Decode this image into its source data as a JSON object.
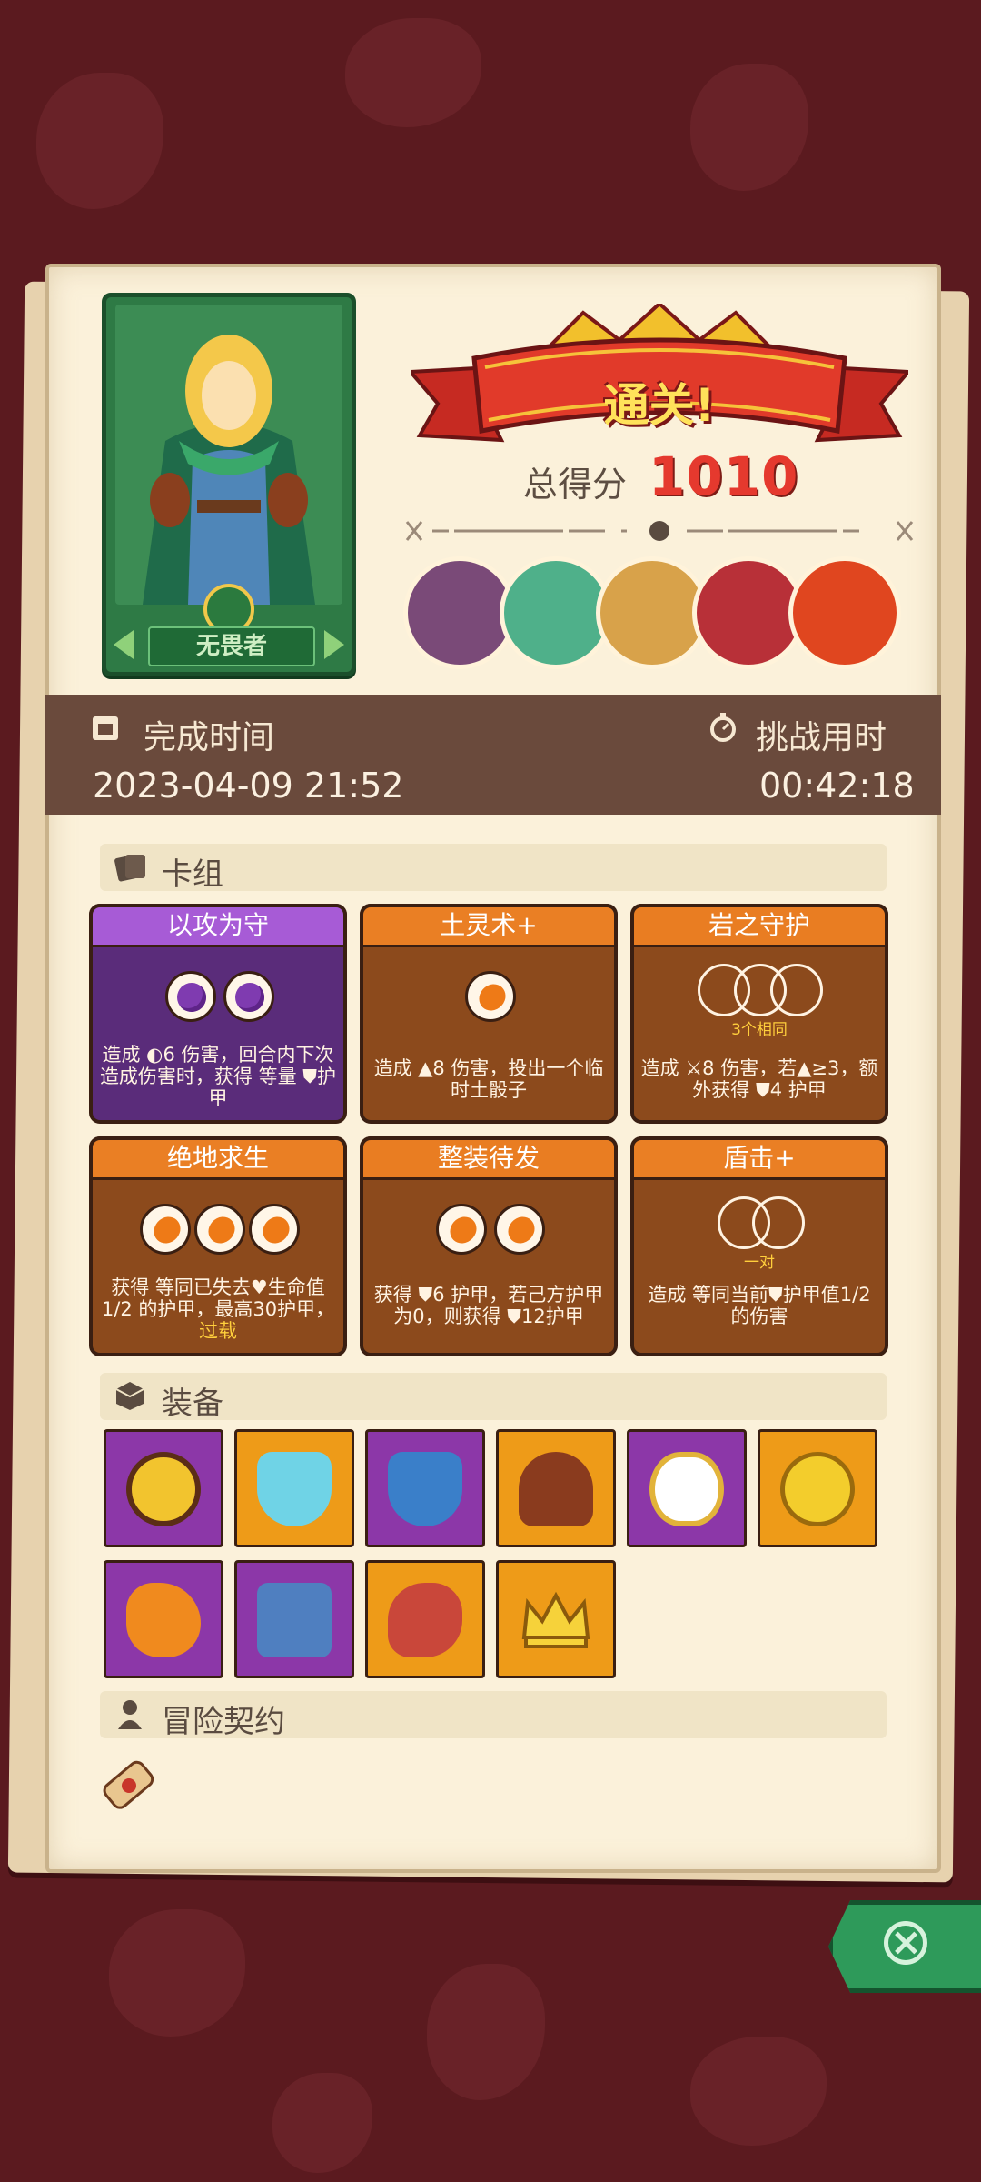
{
  "hero": {
    "name": "无畏者"
  },
  "result": {
    "banner": "通关!",
    "score_label": "总得分",
    "score_value": "1010"
  },
  "bosses": [
    "boss-1",
    "boss-2",
    "boss-3",
    "boss-4",
    "boss-5"
  ],
  "time": {
    "finish_label": "完成时间",
    "finish_value": "2023-04-09 21:52",
    "duration_label": "挑战用时",
    "duration_value": "00:42:18"
  },
  "sections": {
    "deck": "卡组",
    "equipment": "装备",
    "contract": "冒险契约"
  },
  "cards": [
    {
      "title": "以攻为守",
      "desc": "造成 ◐6 伤害，回合内下次造成伤害时，获得 等量 ⛊护甲",
      "sub": ""
    },
    {
      "title": "土灵术+",
      "desc": "造成 ▲8 伤害，投出一个临时土骰子",
      "sub": ""
    },
    {
      "title": "岩之守护",
      "desc": "造成 ⚔8 伤害，若▲≥3，额外获得 ⛊4 护甲",
      "sub": "3个相同"
    },
    {
      "title": "绝地求生",
      "desc": "获得 等同已失去♥生命值1/2 的护甲，最高30护甲，",
      "extra": "过载",
      "sub": ""
    },
    {
      "title": "整装待发",
      "desc": "获得 ⛊6 护甲，若己方护甲为0，则获得 ⛊12护甲",
      "sub": ""
    },
    {
      "title": "盾击+",
      "desc": "造成 等同当前⛊护甲值1/2的伤害",
      "sub": "一对"
    }
  ],
  "equipment": [
    {
      "name": "hex-amulet",
      "bg": "purple"
    },
    {
      "name": "ice-shield",
      "bg": "orange"
    },
    {
      "name": "blue-shield",
      "bg": "purple"
    },
    {
      "name": "leather-hood",
      "bg": "orange"
    },
    {
      "name": "magic-mirror",
      "bg": "purple"
    },
    {
      "name": "gold-coin",
      "bg": "orange"
    },
    {
      "name": "fire-potion",
      "bg": "purple"
    },
    {
      "name": "blue-tunic",
      "bg": "purple"
    },
    {
      "name": "roast-meat",
      "bg": "orange"
    },
    {
      "name": "gold-crown",
      "bg": "orange"
    }
  ],
  "colors": {
    "accent": "#e5392e",
    "panel": "#fbf1da",
    "timebar": "#6a4a3c",
    "background": "#5b1a1f"
  }
}
